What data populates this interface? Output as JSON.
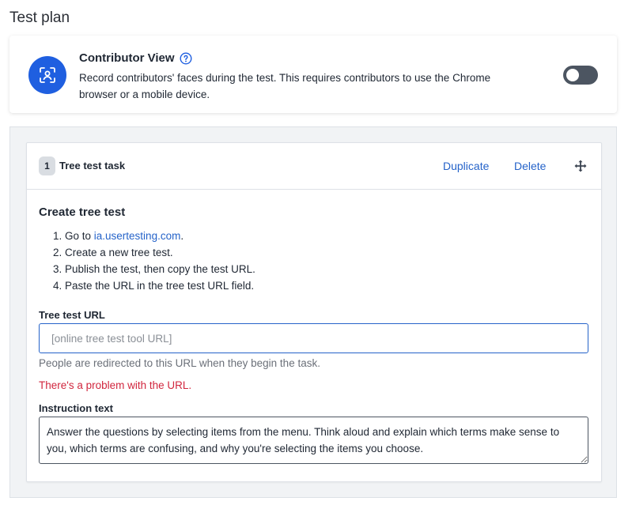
{
  "page": {
    "title": "Test plan"
  },
  "contributor_view": {
    "title": "Contributor View",
    "description": "Record contributors' faces during the test. This requires contributors to use the Chrome browser or a mobile device.",
    "toggle_on": false,
    "icon": "face-scan-icon",
    "colors": {
      "avatar": "#1f5fe0",
      "toggle_off": "#4c5561"
    }
  },
  "task": {
    "number": "1",
    "name": "Tree test task",
    "duplicate_label": "Duplicate",
    "delete_label": "Delete",
    "body_title": "Create tree test",
    "steps": {
      "s1_prefix": "1. Go to ",
      "s1_link": "ia.usertesting.com",
      "s1_suffix": ".",
      "s2": "2. Create a new tree test.",
      "s3": "3. Publish the test, then copy the test URL.",
      "s4": "4. Paste the URL in the tree test URL field."
    },
    "url_field": {
      "label": "Tree test URL",
      "placeholder": "[online tree test tool URL]",
      "value": "",
      "help": "People are redirected to this URL when they begin the task.",
      "error": "There's a problem with the URL."
    },
    "instruction_field": {
      "label": "Instruction text",
      "value": "Answer the questions by selecting items from the menu. Think aloud and explain which terms make sense to you, which terms are confusing, and why you're selecting the items you choose."
    },
    "colors": {
      "link": "#2563c9",
      "error": "#d1263e"
    }
  }
}
